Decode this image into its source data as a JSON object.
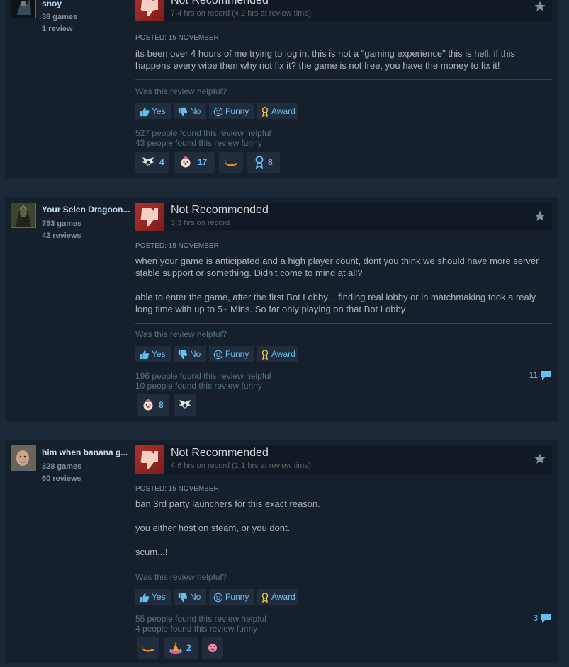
{
  "reviews": [
    {
      "author": "snoy",
      "games": "38 games",
      "reviews": "1 review",
      "recommendation": "Not Recommended",
      "hours": "7.4 hrs on record (4.2 hrs at review time)",
      "posted": "Posted: 15 November",
      "paragraphs": [
        "its been over 4 hours of me trying to log in, this is not a \"gaming experience\" this is hell. if this happens every wipe then why not fix it? the game is not free, you have the money to fix it!"
      ],
      "helpful_question": "Was this review helpful?",
      "buttons": {
        "yes": "Yes",
        "no": "No",
        "funny": "Funny",
        "award": "Award"
      },
      "helpful_count": "527 people found this review helpful",
      "funny_count": "43 people found this review funny",
      "awards": [
        {
          "icon": "winged-badge-icon",
          "count": "4"
        },
        {
          "icon": "clown-face-icon",
          "count": "17"
        },
        {
          "icon": "banana-icon",
          "count": ""
        },
        {
          "icon": "ribbon-award-icon",
          "count": "8"
        }
      ],
      "comments": ""
    },
    {
      "author": "Your Selen Dragoon...",
      "games": "753 games",
      "reviews": "42 reviews",
      "recommendation": "Not Recommended",
      "hours": "3.3 hrs on record",
      "posted": "Posted: 15 November",
      "paragraphs": [
        "when your game is anticipated and a high player count, dont you think we should have more server stable support or something. Didn't come to mind at all?",
        "able to enter the game, after the first Bot Lobby .. finding real lobby or in matchmaking took a realy long time with up to 5+ Mins. So far only playing on that Bot Lobby"
      ],
      "helpful_question": "Was this review helpful?",
      "buttons": {
        "yes": "Yes",
        "no": "No",
        "funny": "Funny",
        "award": "Award"
      },
      "helpful_count": "196 people found this review helpful",
      "funny_count": "10 people found this review funny",
      "awards": [
        {
          "icon": "clown-face-icon",
          "count": "8"
        },
        {
          "icon": "winged-badge-icon",
          "count": ""
        }
      ],
      "comments": "11"
    },
    {
      "author": "him when banana g...",
      "games": "328 games",
      "reviews": "60 reviews",
      "recommendation": "Not Recommended",
      "hours": "4.6 hrs on record (1.1 hrs at review time)",
      "posted": "Posted: 15 November",
      "paragraphs": [
        "ban 3rd party launchers for this exact reason.",
        "you either host on steam, or you dont.",
        "scum...!"
      ],
      "helpful_question": "Was this review helpful?",
      "buttons": {
        "yes": "Yes",
        "no": "No",
        "funny": "Funny",
        "award": "Award"
      },
      "helpful_count": "55 people found this review helpful",
      "funny_count": "4 people found this review funny",
      "awards": [
        {
          "icon": "banana-icon",
          "count": ""
        },
        {
          "icon": "party-hat-icon",
          "count": "2"
        },
        {
          "icon": "pig-face-icon",
          "count": ""
        }
      ],
      "comments": "3"
    }
  ],
  "colors": {
    "background": "#1b2838",
    "card": "#16202d",
    "link": "#66c0f4",
    "not_recommended": "#a3302c"
  }
}
